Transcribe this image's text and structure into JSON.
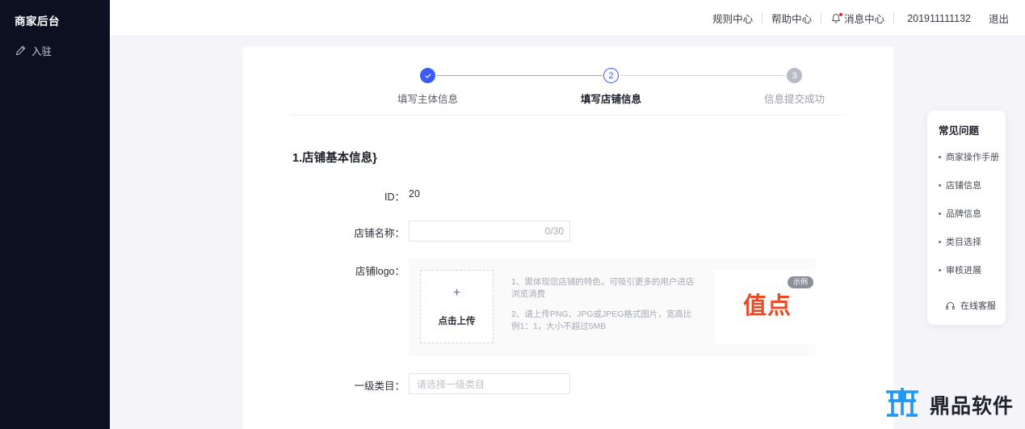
{
  "sidebar": {
    "title": "商家后台",
    "items": [
      {
        "label": "入驻",
        "icon": "pen-icon"
      }
    ]
  },
  "header": {
    "nav": [
      {
        "label": "规则中心"
      },
      {
        "label": "帮助中心"
      },
      {
        "label": "消息中心",
        "icon": "bell-icon",
        "has_badge": true
      }
    ],
    "user_id": "201911111132",
    "logout_label": "退出"
  },
  "stepper": {
    "steps": [
      {
        "num": "✓",
        "label": "填写主体信息",
        "state": "done"
      },
      {
        "num": "2",
        "label": "填写店铺信息",
        "state": "active"
      },
      {
        "num": "3",
        "label": "信息提交成功",
        "state": "todo"
      }
    ]
  },
  "form": {
    "section_title": "1.店铺基本信息}",
    "id_label": "ID：",
    "id_value": "20",
    "shop_name_label": "店铺名称：",
    "shop_name_value": "",
    "shop_name_counter": "0/30",
    "logo_label": "店铺logo：",
    "upload_plus": "+",
    "upload_text": "点击上传",
    "upload_tips": [
      "1、需体现您店铺的特色，可吸引更多的用户进店浏览消费",
      "2、请上传PNG、JPG或JPEG格式图片，宽高比例1：1，大小不超过5MB"
    ],
    "sample_logo_text": "值点",
    "sample_badge": "示例",
    "category_label": "一级类目：",
    "category_placeholder": "请选择一级类目"
  },
  "faq": {
    "title": "常见问题",
    "items": [
      {
        "label": "商家操作手册"
      },
      {
        "label": "店铺信息"
      },
      {
        "label": "品牌信息"
      },
      {
        "label": "类目选择"
      },
      {
        "label": "审核进展"
      }
    ],
    "service_label": "在线客服"
  },
  "watermark": {
    "text": "鼎品软件"
  },
  "colors": {
    "accent": "#3b5bfd",
    "sidebar_bg": "#0d1021",
    "page_bg": "#f4f4f9",
    "sample_logo": "#ec4a25",
    "badge_red": "#f5222d",
    "watermark_blue": "#2196f3"
  }
}
